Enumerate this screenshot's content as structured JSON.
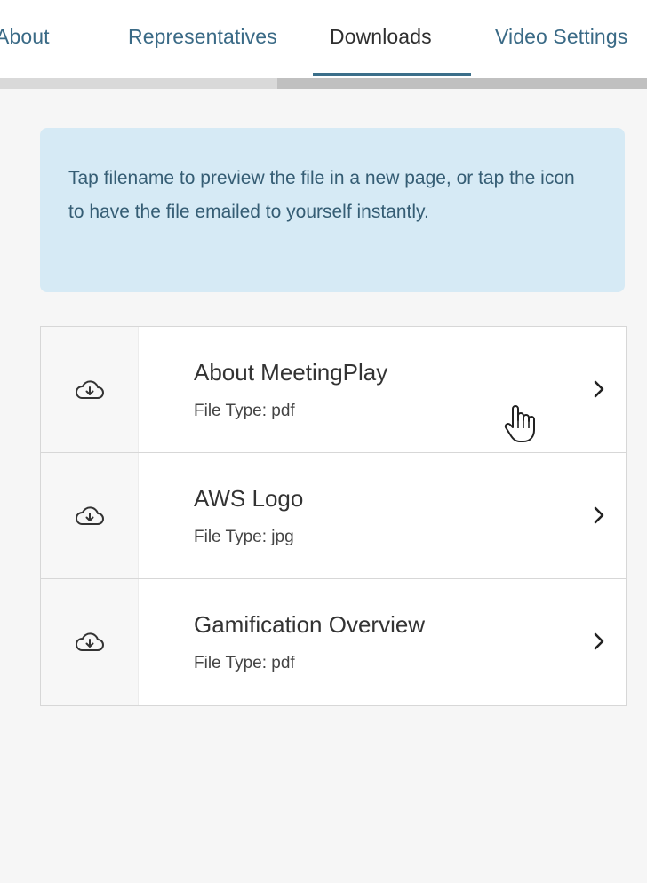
{
  "tabs": [
    {
      "label": "About",
      "active": false
    },
    {
      "label": "Representatives",
      "active": false
    },
    {
      "label": "Downloads",
      "active": true
    },
    {
      "label": "Video Settings",
      "active": false
    }
  ],
  "info": {
    "message": "Tap filename to preview the file in a new page, or tap the icon to have the file emailed to yourself instantly."
  },
  "downloads": [
    {
      "name": "About MeetingPlay",
      "type": "File Type: pdf",
      "icon": "cloud-download-icon"
    },
    {
      "name": "AWS Logo",
      "type": "File Type: jpg",
      "icon": "cloud-download-icon"
    },
    {
      "name": "Gamification Overview",
      "type": "File Type: pdf",
      "icon": "cloud-download-icon"
    }
  ],
  "colors": {
    "accent": "#3b6f8a",
    "info_bg": "#d6eaf5",
    "info_text": "#355d74"
  }
}
